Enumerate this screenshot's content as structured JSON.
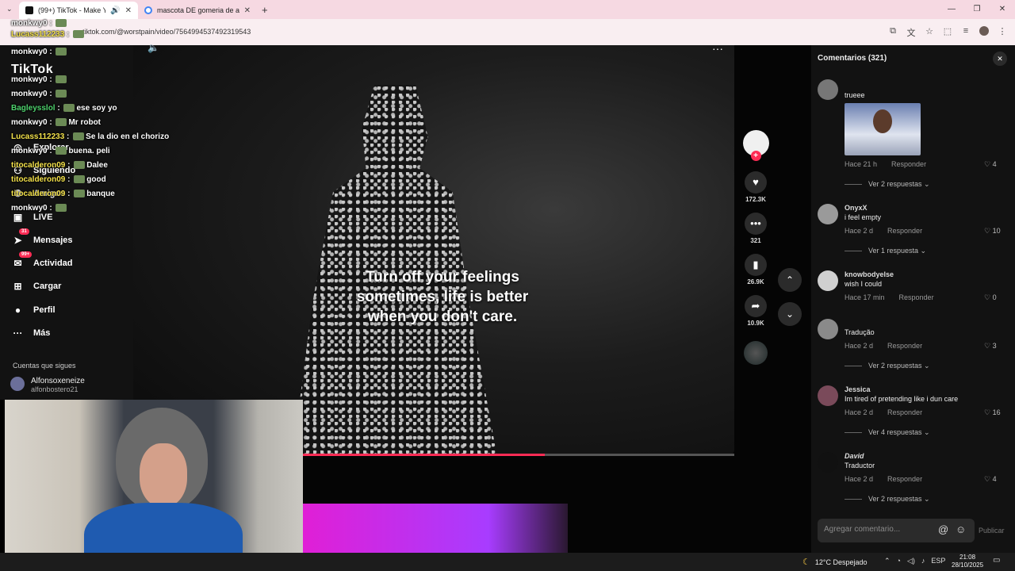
{
  "browser": {
    "tabs": [
      {
        "title": "(99+) TikTok - Make Your Da",
        "active": true
      },
      {
        "title": "mascota DE gomeria de autos",
        "active": false
      }
    ],
    "url": "tiktok.com/@worstpain/video/7564994537492319543",
    "icons": [
      "tab-search-icon",
      "back-icon",
      "screenshot-icon",
      "translate-icon",
      "star-icon",
      "extensions-icon",
      "sidebar-icon",
      "profile-icon",
      "menu-icon"
    ]
  },
  "sidebar": {
    "logo": "TikTok",
    "items": [
      {
        "label": "Explorar",
        "icon": "compass-icon"
      },
      {
        "label": "Siguiendo",
        "icon": "following-icon"
      },
      {
        "label": "Amigos",
        "icon": "friends-icon"
      },
      {
        "label": "LIVE",
        "icon": "live-icon"
      },
      {
        "label": "Mensajes",
        "icon": "messages-icon",
        "badge": "31"
      },
      {
        "label": "Actividad",
        "icon": "activity-icon",
        "badge": "99+"
      },
      {
        "label": "Cargar",
        "icon": "upload-icon"
      },
      {
        "label": "Perfil",
        "icon": "profile-icon"
      },
      {
        "label": "Más",
        "icon": "more-icon"
      }
    ],
    "following_header": "Cuentas que sigues",
    "following": [
      {
        "name": "Alfonsoxeneize",
        "handle": "alfonbostero21"
      }
    ]
  },
  "chat": [
    {
      "user": "monkwy0",
      "text": "",
      "color": "white"
    },
    {
      "user": "Lucass112233",
      "text": "",
      "color": "yellow"
    },
    {
      "user": "monkwy0",
      "text": "",
      "color": "white"
    },
    {
      "user": "monkwy0",
      "text": "",
      "color": "white"
    },
    {
      "user": "monkwy0",
      "text": "",
      "color": "white"
    },
    {
      "user": "Bagleysslol",
      "text": "ese soy yo",
      "color": "green"
    },
    {
      "user": "monkwy0",
      "text": "Mr robot",
      "color": "white"
    },
    {
      "user": "Lucass112233",
      "text": "Se la dio en el chorizo",
      "color": "yellow"
    },
    {
      "user": "monkwy0",
      "text": "buena. peli",
      "color": "white"
    },
    {
      "user": "titocalderon09",
      "text": "Dalee",
      "color": "yellow"
    },
    {
      "user": "titocalderon09",
      "text": "good",
      "color": "yellow"
    },
    {
      "user": "titocalderon09",
      "text": "banque",
      "color": "yellow"
    },
    {
      "user": "monkwy0",
      "text": "",
      "color": "white"
    }
  ],
  "video": {
    "caption": "Turn off your feelings\nsometimes, life is better\nwhen you don't care.",
    "progress": 0.56,
    "likes": "172.3K",
    "comments": "321",
    "saves": "26.9K",
    "shares": "10.9K"
  },
  "comments_panel": {
    "title": "Comentarios (321)",
    "input_placeholder": "Agregar comentario...",
    "post_label": "Publicar",
    "items": [
      {
        "user": "",
        "text": "trueee",
        "time": "Hace 21 h",
        "reply": "Responder",
        "likes": "4",
        "replies": "Ver 2 respuestas",
        "has_gif": true
      },
      {
        "user": "OnyxX",
        "text": "i feel empty",
        "time": "Hace 2 d",
        "reply": "Responder",
        "likes": "10",
        "replies": "Ver 1 respuesta"
      },
      {
        "user": "knowbodyelse",
        "text": "wish I could",
        "time": "Hace 17 min",
        "reply": "Responder",
        "likes": "0",
        "replies": ""
      },
      {
        "user": "",
        "text": "Tradução",
        "time": "Hace 2 d",
        "reply": "Responder",
        "likes": "3",
        "replies": "Ver 2 respuestas"
      },
      {
        "user": "Jessica",
        "text": "Im tired of pretending like i dun care",
        "time": "Hace 2 d",
        "reply": "Responder",
        "likes": "16",
        "replies": "Ver 4 respuestas"
      },
      {
        "user": "David",
        "text": "Traductor",
        "time": "Hace 2 d",
        "reply": "Responder",
        "likes": "4",
        "replies": "Ver 2 respuestas"
      }
    ]
  },
  "taskbar": {
    "weather": "12°C Despejado",
    "lang": "ESP",
    "time": "21:08",
    "date": "28/10/2025"
  },
  "colors": {
    "accent": "#fe2c55",
    "tabbar": "#f6d9e2",
    "panel": "#121212"
  }
}
